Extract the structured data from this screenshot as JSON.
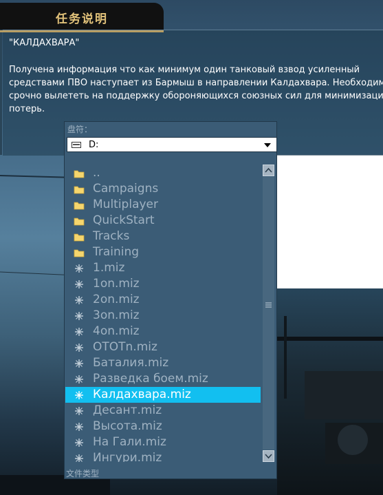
{
  "header": {
    "tab_title": "任务说明"
  },
  "briefing": {
    "title": "\"КАЛДАХВАРА\"",
    "lines": [
      "Получена информация что как минимум один танковый взвод усиленный",
      "средствами ПВО наступает из Бармыш в направлении Калдахвара. Необходимо",
      "срочно вылететь на поддержку обороняющихся союзных сил для минимизации",
      "потерь."
    ]
  },
  "file_dialog": {
    "drive_label": "盘符：",
    "drive_value": "D:",
    "drive_icon": "drive-icon",
    "filetype_label": "文件类型",
    "items": [
      {
        "name": "..",
        "icon": "folder-icon",
        "selected": false
      },
      {
        "name": "Campaigns",
        "icon": "folder-icon",
        "selected": false
      },
      {
        "name": "Multiplayer",
        "icon": "folder-icon",
        "selected": false
      },
      {
        "name": "QuickStart",
        "icon": "folder-icon",
        "selected": false
      },
      {
        "name": "Tracks",
        "icon": "folder-icon",
        "selected": false
      },
      {
        "name": "Training",
        "icon": "folder-icon",
        "selected": false
      },
      {
        "name": "1.miz",
        "icon": "mission-file-icon",
        "selected": false
      },
      {
        "name": "1on.miz",
        "icon": "mission-file-icon",
        "selected": false
      },
      {
        "name": "2on.miz",
        "icon": "mission-file-icon",
        "selected": false
      },
      {
        "name": "3on.miz",
        "icon": "mission-file-icon",
        "selected": false
      },
      {
        "name": "4on.miz",
        "icon": "mission-file-icon",
        "selected": false
      },
      {
        "name": "OTOTn.miz",
        "icon": "mission-file-icon",
        "selected": false
      },
      {
        "name": "Баталия.miz",
        "icon": "mission-file-icon",
        "selected": false
      },
      {
        "name": "Разведка боем.miz",
        "icon": "mission-file-icon",
        "selected": false
      },
      {
        "name": "Калдахвара.miz",
        "icon": "mission-file-icon",
        "selected": true
      },
      {
        "name": "Десант.miz",
        "icon": "mission-file-icon",
        "selected": false
      },
      {
        "name": "Высота.miz",
        "icon": "mission-file-icon",
        "selected": false
      },
      {
        "name": "На Гали.miz",
        "icon": "mission-file-icon",
        "selected": false
      },
      {
        "name": "Ингури.miz",
        "icon": "mission-file-icon",
        "selected": false
      }
    ]
  },
  "colors": {
    "accent": "#12bff0",
    "tab_text": "#e2c27a",
    "list_text": "#9fb2c2"
  }
}
